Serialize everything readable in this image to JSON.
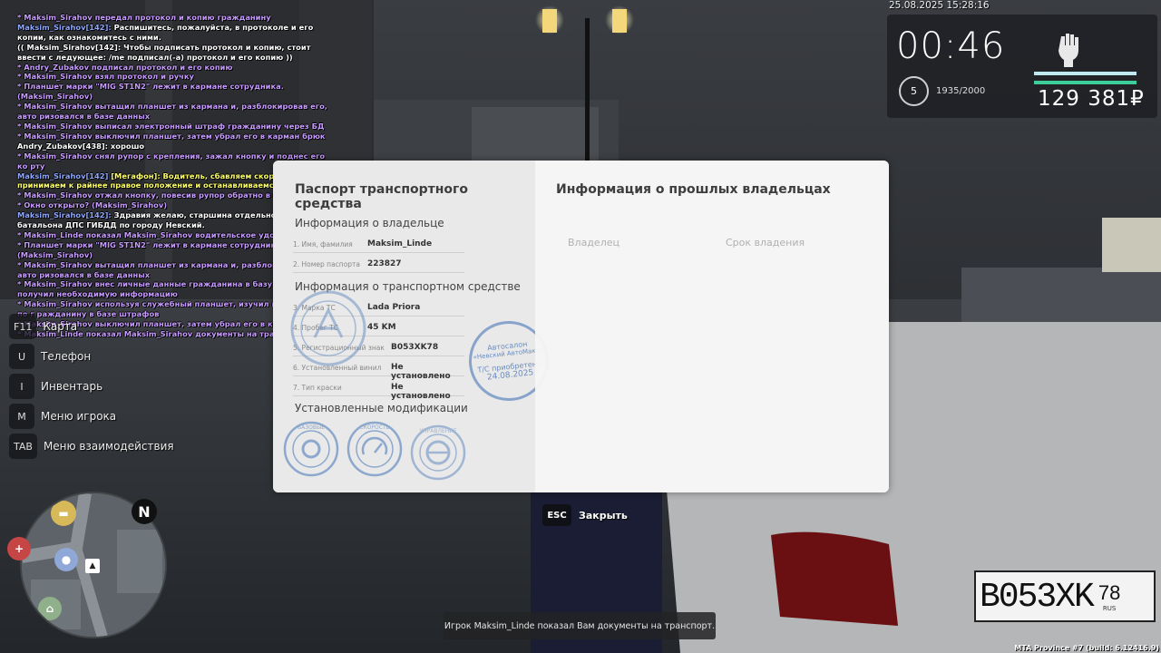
{
  "chat": [
    {
      "parts": [
        {
          "text": "* Maksim_Sirahov передал протокол и копию гражданину",
          "cls": "c-me"
        }
      ]
    },
    {
      "parts": [
        {
          "text": "Maksim_Sirahov[142]: ",
          "cls": "name"
        },
        {
          "text": "Распишитесь, пожалуйста, в протоколе и его копии, как ознакомитесь с ними.",
          "cls": "c-white"
        }
      ]
    },
    {
      "parts": [
        {
          "text": "(( Maksim_Sirahov[142]: Чтобы подписать протокол и копию, стоит ввести с ледующее: /me подписал(-а) протокол и его копию ))",
          "cls": "c-white"
        }
      ]
    },
    {
      "parts": [
        {
          "text": "* Andry_Zubakov подписал протокол и его копию",
          "cls": "c-me"
        }
      ]
    },
    {
      "parts": [
        {
          "text": "* Maksim_Sirahov взял протокол и ручку",
          "cls": "c-me"
        }
      ]
    },
    {
      "parts": [
        {
          "text": "* Планшет марки \"MIG ST1N2\" лежит в кармане сотрудника. (Maksim_Sirahov)",
          "cls": "c-me"
        }
      ]
    },
    {
      "parts": [
        {
          "text": "* Maksim_Sirahov вытащил планшет из кармана и, разблокировав его, авто ризовался в базе данных",
          "cls": "c-me"
        }
      ]
    },
    {
      "parts": [
        {
          "text": "* Maksim_Sirahov выписал электронный штраф гражданину через БД",
          "cls": "c-me"
        }
      ]
    },
    {
      "parts": [
        {
          "text": "* Maksim_Sirahov выключил планшет, затем убрал его в карман брюк",
          "cls": "c-me"
        }
      ]
    },
    {
      "parts": [
        {
          "text": "Andry_Zubakov[438]: хорошо",
          "cls": "c-white"
        }
      ]
    },
    {
      "parts": [
        {
          "text": "* Maksim_Sirahov снял рупор с крепления, зажал кнопку и поднес его ко рту",
          "cls": "c-me"
        }
      ]
    },
    {
      "parts": [
        {
          "text": "Maksim_Sirahov[142] ",
          "cls": "name"
        },
        {
          "text": "[Мегафон]: Водитель, сбавляем скорость, принимаем к райнее правое положение и останавливаемся.",
          "cls": "c-yellow"
        }
      ]
    },
    {
      "parts": [
        {
          "text": "* Maksim_Sirahov отжал кнопку, повесив рупор обратно в крепление",
          "cls": "c-me"
        }
      ]
    },
    {
      "parts": [
        {
          "text": "* Окно открыто? (Maksim_Sirahov)",
          "cls": "c-me"
        }
      ]
    },
    {
      "parts": [
        {
          "text": "Maksim_Sirahov[142]: ",
          "cls": "name"
        },
        {
          "text": "Здравия желаю, старшина отдельного батальона ДПС ГИБДД по городу Невский.",
          "cls": "c-white"
        }
      ]
    },
    {
      "parts": [
        {
          "text": "* Maksim_Linde показал Maksim_Sirahov водительское удостоверение",
          "cls": "c-me"
        }
      ]
    },
    {
      "parts": [
        {
          "text": "* Планшет марки \"MIG ST1N2\" лежит в кармане сотрудника. (Maksim_Sirahov)",
          "cls": "c-me"
        }
      ]
    },
    {
      "parts": [
        {
          "text": "* Maksim_Sirahov вытащил планшет из кармана и, разблокировав его, авто ризовался в базе данных",
          "cls": "c-me"
        }
      ]
    },
    {
      "parts": [
        {
          "text": "* Maksim_Sirahov внес личные данные гражданина в базу данных и получил необходимую информацию",
          "cls": "c-me"
        }
      ]
    },
    {
      "parts": [
        {
          "text": "* Maksim_Sirahov используя служебный планшет, изучил информацию по г ражданину в базе штрафов",
          "cls": "c-me"
        }
      ]
    },
    {
      "parts": [
        {
          "text": "* Maksim_Sirahov выключил планшет, затем убрал его в карман брюк",
          "cls": "c-me"
        }
      ]
    },
    {
      "parts": [
        {
          "text": "* Maksim_Linde показал Maksim_Sirahov документы на транспорт",
          "cls": "c-me"
        }
      ]
    }
  ],
  "keymenu": [
    {
      "key": "F11",
      "label": "Карта"
    },
    {
      "key": "U",
      "label": "Телефон"
    },
    {
      "key": "I",
      "label": "Инвентарь"
    },
    {
      "key": "M",
      "label": "Меню игрока"
    },
    {
      "key": "TAB",
      "label": "Меню взаимодействия"
    }
  ],
  "hud": {
    "datetime": "25.08.2025 15:28:16",
    "timer": "00:46",
    "level": "5",
    "exp": "1935/2000",
    "money": "129 381₽",
    "health_color": "#bfe8f0",
    "armor_color": "#3ccf9a"
  },
  "minimap": {
    "north": "N"
  },
  "document": {
    "title_left": "Паспорт транспортного средства",
    "title_right": "Информация о прошлых владельцах",
    "owner_section": "Информация о владельце",
    "vehicle_section": "Информация о транспортном средстве",
    "mods_section": "Установленные модификации",
    "owner_fields": [
      {
        "label": "1. Имя, фамилия",
        "value": "Maksim_Linde"
      },
      {
        "label": "2. Номер паспорта",
        "value": "223827"
      }
    ],
    "vehicle_fields": [
      {
        "label": "3. Марка ТС",
        "value": "Lada Priora"
      },
      {
        "label": "4. Пробег ТС",
        "value": "45 KM"
      },
      {
        "label": "5. Регистрационный знак",
        "value": "B053XK78"
      },
      {
        "label": "6. Установленный винил",
        "value": "Не установлено"
      },
      {
        "label": "7. Тип краски",
        "value": "Не установлено"
      }
    ],
    "col_owner": "Владелец",
    "col_period": "Срок владения",
    "stamp": {
      "line1": "Автосалон",
      "line2": "«Невский АвтоМакс»",
      "line3": "Т/С приобретено",
      "line4": "24.08.2025"
    },
    "mod_badges": [
      "БАЗОВЫЕ",
      "СКОРОСТЬ",
      "УПРАВЛЕНИЕ"
    ]
  },
  "close": {
    "key": "ESC",
    "label": "Закрыть"
  },
  "notification": "Игрок Maksim_Linde показал Вам документы на транспорт.",
  "build": "MTA Province #7 (build: 6.12416.9)",
  "plate": {
    "text": "B053XK",
    "region": "78",
    "rus": "RUS"
  }
}
